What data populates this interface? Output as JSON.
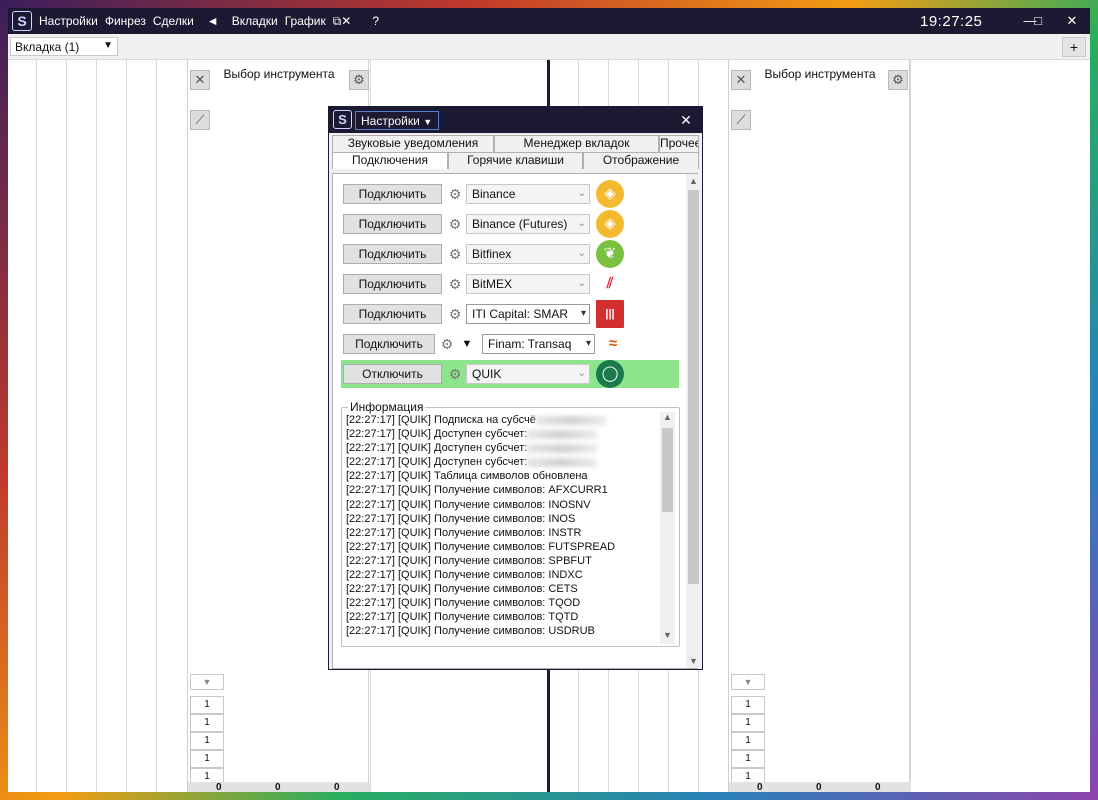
{
  "app": {
    "menu": [
      "Настройки",
      "Финрез",
      "Сделки",
      "◄",
      "Вкладки",
      "График",
      "⧉✕",
      "?"
    ],
    "clock": "19:27:25",
    "window_buttons": {
      "minimize": "—",
      "maximize": "□",
      "close": "✕"
    },
    "logo_glyph": "S"
  },
  "tabbar": {
    "selected_tab": "Вкладка (1)",
    "add_label": "+"
  },
  "panels": [
    {
      "title": "Выбор инструмента",
      "cells": [
        "1",
        "1",
        "1",
        "1",
        "1"
      ],
      "zeros": [
        "0",
        "0",
        "0"
      ]
    },
    {
      "title": "Выбор инструмента",
      "cells": [
        "1",
        "1",
        "1",
        "1",
        "1"
      ],
      "zeros": [
        "0",
        "0",
        "0"
      ]
    }
  ],
  "dialog": {
    "menu_label": "Настройки",
    "close_label": "✕",
    "tabs_top": [
      "Звуковые уведомления",
      "Менеджер вкладок",
      "Прочее"
    ],
    "tabs_bottom": [
      "Подключения",
      "Горячие клавиши",
      "Отображение"
    ],
    "active_tab": "Подключения",
    "connections": [
      {
        "button": "Подключить",
        "exchange": "Binance",
        "enabled": false,
        "icon": "binance-logo",
        "color": "#f3ba2f",
        "glyph": "◈"
      },
      {
        "button": "Подключить",
        "exchange": "Binance (Futures)",
        "enabled": false,
        "icon": "binance-logo",
        "color": "#f3ba2f",
        "glyph": "◈"
      },
      {
        "button": "Подключить",
        "exchange": "Bitfinex",
        "enabled": false,
        "icon": "bitfinex-logo",
        "color": "#7ac142",
        "glyph": "❦"
      },
      {
        "button": "Подключить",
        "exchange": "BitMEX",
        "enabled": false,
        "icon": "bitmex-logo",
        "color": "#e2304a",
        "glyph": "⫽"
      },
      {
        "button": "Подключить",
        "exchange": "ITI Capital: SMAR",
        "enabled": true,
        "icon": "iti-capital-logo",
        "color": "#d32f2f",
        "glyph": "|||"
      },
      {
        "button": "Подключить",
        "exchange": "Finam: Transaq",
        "enabled": true,
        "icon": "finam-logo",
        "color": "#d35400",
        "glyph": "≈"
      },
      {
        "button": "Отключить",
        "exchange": "QUIK",
        "enabled": false,
        "icon": "quik-logo",
        "color": "#1a7a4a",
        "glyph": "◯",
        "active": true
      }
    ],
    "info_title": "Информация",
    "log": [
      {
        "text": "[22:27:17] [QUIK] Подписка на субсчё",
        "blurred": true
      },
      {
        "text": "[22:27:17] [QUIK] Доступен субсчет:",
        "blurred": true
      },
      {
        "text": "[22:27:17] [QUIK] Доступен субсчет:",
        "blurred": true
      },
      {
        "text": "[22:27:17] [QUIK] Доступен субсчет:",
        "blurred": true
      },
      {
        "text": "[22:27:17] [QUIK] Таблица символов обновлена"
      },
      {
        "text": "[22:27:17] [QUIK] Получение символов: AFXCURR1"
      },
      {
        "text": "[22:27:17] [QUIK] Получение символов: INOSNV"
      },
      {
        "text": "[22:27:17] [QUIK] Получение символов: INOS"
      },
      {
        "text": "[22:27:17] [QUIK] Получение символов: INSTR"
      },
      {
        "text": "[22:27:17] [QUIK] Получение символов: FUTSPREAD"
      },
      {
        "text": "[22:27:17] [QUIK] Получение символов: SPBFUT"
      },
      {
        "text": "[22:27:17] [QUIK] Получение символов: INDXC"
      },
      {
        "text": "[22:27:17] [QUIK] Получение символов: CETS"
      },
      {
        "text": "[22:27:17] [QUIK] Получение символов: TQOD"
      },
      {
        "text": "[22:27:17] [QUIK] Получение символов: TQTD"
      },
      {
        "text": "[22:27:17] [QUIK] Получение символов: USDRUB"
      }
    ]
  }
}
